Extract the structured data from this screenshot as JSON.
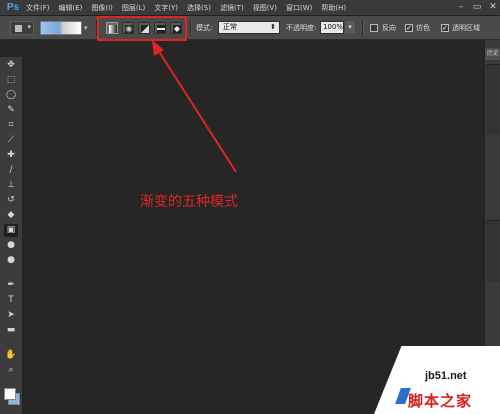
{
  "app": {
    "logo": "Ps"
  },
  "menu": [
    "文件(F)",
    "编辑(E)",
    "图像(I)",
    "图层(L)",
    "文字(Y)",
    "选择(S)",
    "滤镜(T)",
    "视图(V)",
    "窗口(W)",
    "帮助(H)"
  ],
  "window_controls": {
    "minimize": "–",
    "restore": "▭",
    "close": "✕"
  },
  "options": {
    "mode_label": "模式:",
    "mode_value": "正常",
    "opacity_label": "不透明度:",
    "opacity_value": "100%",
    "reverse_label": "反向",
    "dither_label": "仿色",
    "transparency_label": "透明区域",
    "reverse_checked": false,
    "dither_checked": true,
    "transparency_checked": true,
    "gradient_modes": [
      "linear-gradient",
      "radial-gradient",
      "angle-gradient",
      "reflected-gradient",
      "diamond-gradient"
    ],
    "active_mode_index": 0
  },
  "toolbar": {
    "tools": [
      "move-icon",
      "marquee-icon",
      "lasso-icon",
      "quick-select-icon",
      "crop-icon",
      "eyedropper-icon",
      "healing-brush-icon",
      "brush-icon",
      "clone-stamp-icon",
      "history-brush-icon",
      "eraser-icon",
      "gradient-icon",
      "blur-icon",
      "dodge-icon",
      "pen-icon",
      "type-icon",
      "path-select-icon",
      "shape-icon",
      "hand-icon",
      "zoom-icon"
    ],
    "active_tool": "gradient-icon"
  },
  "right_panel": {
    "tab_label": "历史"
  },
  "annotation": {
    "text": "渐变的五种模式",
    "color": "#e02323"
  },
  "watermark": {
    "site": "jb51.net",
    "name": "脚本之家"
  },
  "colors": {
    "foreground": "#ffffff",
    "background": "#8fb5df",
    "canvas": "#262626"
  }
}
